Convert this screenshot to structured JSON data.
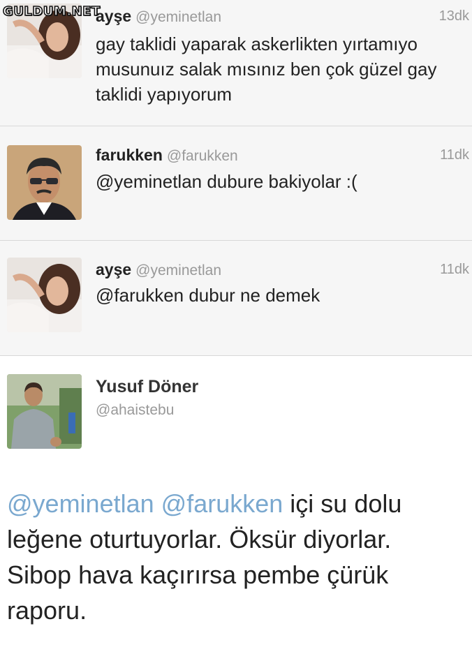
{
  "watermark": "GULDUM.NET",
  "tweets": [
    {
      "name": "ayşe",
      "handle": "@yeminetlan",
      "time": "13dk",
      "text": "gay taklidi yaparak askerlikten yırtamıyo musunuız salak mısınız ben çok güzel gay taklidi yapıyorum",
      "avatar": "woman-lying-photo"
    },
    {
      "name": "farukken",
      "handle": "@farukken",
      "time": "11dk",
      "text": "@yeminetlan dubure bakiyolar :(",
      "avatar": "man-sunglasses-photo"
    },
    {
      "name": "ayşe",
      "handle": "@yeminetlan",
      "time": "11dk",
      "text": "@farukken dubur ne demek",
      "avatar": "woman-lying-photo"
    }
  ],
  "detail": {
    "name": "Yusuf Döner",
    "handle": "@ahaistebu",
    "mention1": "@yeminetlan",
    "mention2": "@farukken",
    "text": "içi su dolu leğene oturtuyorlar. Öksür diyorlar. Sibop hava kaçırırsa pembe çürük raporu.",
    "avatar": "man-grey-tshirt-photo"
  },
  "colors": {
    "mention": "#7aa8cf",
    "meta": "#999999",
    "text": "#222222"
  }
}
